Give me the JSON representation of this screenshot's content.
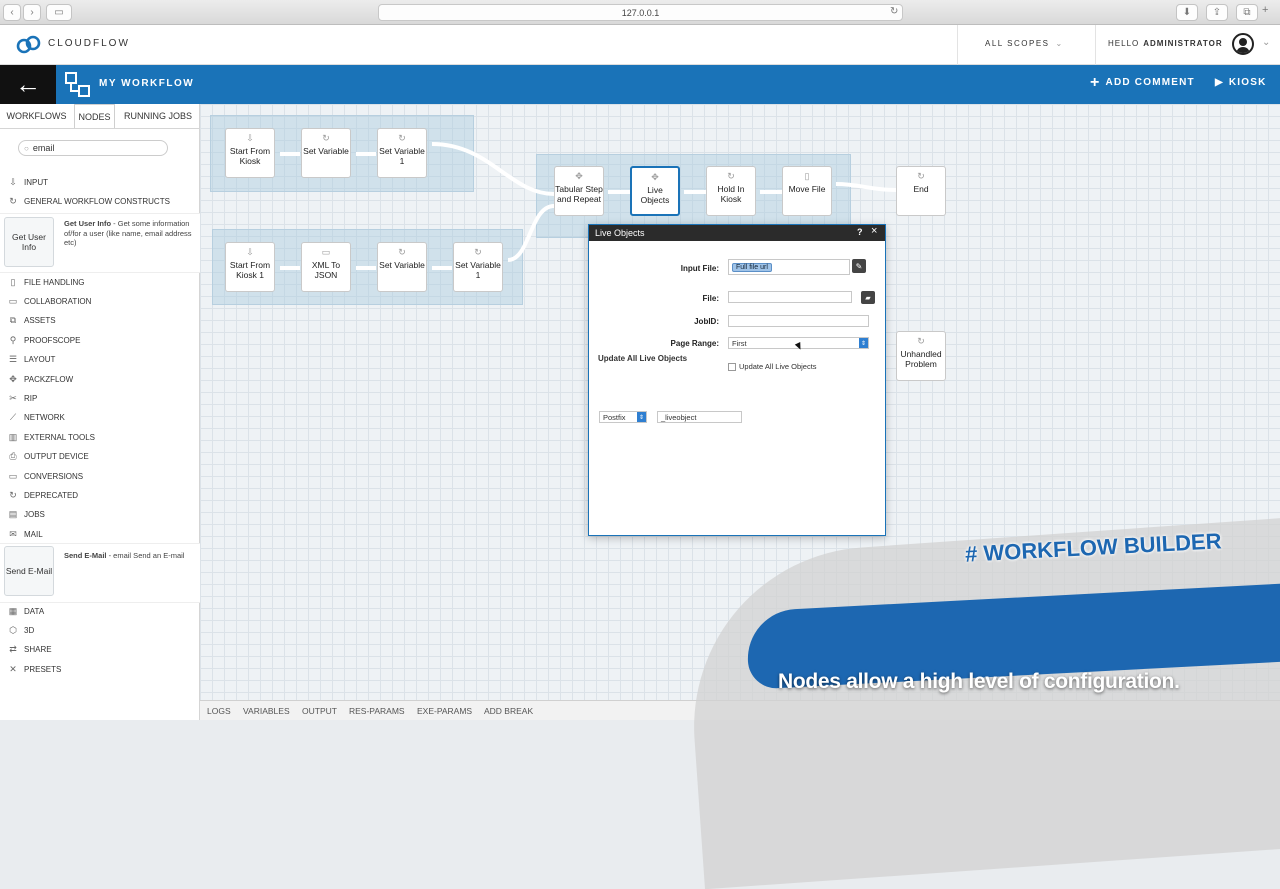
{
  "browser": {
    "url": "127.0.0.1"
  },
  "header": {
    "brand": "CLOUDFLOW",
    "scopes": "ALL SCOPES",
    "greeting": "HELLO",
    "user": "ADMINISTRATOR"
  },
  "toolbar": {
    "title": "MY WORKFLOW",
    "add_comment": "ADD COMMENT",
    "kiosk": "KIOSK"
  },
  "sidebar": {
    "tabs": [
      "WORKFLOWS",
      "NODES",
      "RUNNING JOBS"
    ],
    "search_value": "email",
    "categories_top": [
      {
        "label": "INPUT",
        "icon": "input-icon"
      },
      {
        "label": "GENERAL WORKFLOW CONSTRUCTS",
        "icon": "cycle-icon"
      }
    ],
    "card1": {
      "title": "Get User Info",
      "name": "Get User Info",
      "desc": " - Get some information of/for a user (like name, email address etc)"
    },
    "categories_mid": [
      {
        "label": "FILE HANDLING",
        "icon": "file-icon"
      },
      {
        "label": "COLLABORATION",
        "icon": "collaboration-icon"
      },
      {
        "label": "ASSETS",
        "icon": "assets-icon"
      },
      {
        "label": "PROOFSCOPE",
        "icon": "proofscope-icon"
      },
      {
        "label": "LAYOUT",
        "icon": "layout-icon"
      },
      {
        "label": "PACKZFLOW",
        "icon": "packzflow-icon"
      },
      {
        "label": "RIP",
        "icon": "rip-icon"
      },
      {
        "label": "NETWORK",
        "icon": "network-icon"
      },
      {
        "label": "EXTERNAL TOOLS",
        "icon": "tools-icon"
      },
      {
        "label": "OUTPUT DEVICE",
        "icon": "output-icon"
      },
      {
        "label": "CONVERSIONS",
        "icon": "conversions-icon"
      },
      {
        "label": "DEPRECATED",
        "icon": "deprecated-icon"
      },
      {
        "label": "JOBS",
        "icon": "jobs-icon"
      },
      {
        "label": "MAIL",
        "icon": "mail-icon"
      }
    ],
    "card2": {
      "title": "Send E-Mail",
      "name": "Send E-Mail",
      "desc": " - email Send an E-mail"
    },
    "categories_bottom": [
      {
        "label": "DATA",
        "icon": "data-icon"
      },
      {
        "label": "3D",
        "icon": "3d-icon"
      },
      {
        "label": "SHARE",
        "icon": "share-icon"
      },
      {
        "label": "PRESETS",
        "icon": "presets-icon"
      }
    ]
  },
  "nodes": {
    "start_kiosk": "Start From Kiosk",
    "set_variable": "Set Variable",
    "set_variable_1": "Set Variable 1",
    "start_kiosk_1": "Start From Kiosk 1",
    "xml_json": "XML To JSON",
    "set_variable_b": "Set Variable",
    "set_variable_1b": "Set Variable 1",
    "tabular": "Tabular Step and Repeat",
    "live_objects": "Live Objects",
    "hold_kiosk": "Hold In Kiosk",
    "move_file": "Move File",
    "end": "End",
    "unhandled": "Unhandled Problem"
  },
  "dialog": {
    "title": "Live Objects",
    "help": "?",
    "close": "×",
    "input_file_label": "Input File:",
    "input_file_chip": "Full file url",
    "file_label": "File:",
    "jobid_label": "JobID:",
    "page_range_label": "Page Range:",
    "page_range_value": "First",
    "update_label": "Update All Live Objects",
    "update_checkbox": "Update All Live Objects",
    "postfix_select": "Postfix",
    "postfix_value": "_liveobject"
  },
  "bottombar": [
    "LOGS",
    "VARIABLES",
    "OUTPUT",
    "RES-PARAMS",
    "EXE-PARAMS",
    "ADD BREAK"
  ],
  "overlay": {
    "hashtag": "# WORKFLOW BUILDER",
    "caption": "Nodes allow a high level of configuration."
  },
  "colors": {
    "brand_blue": "#1a73b8",
    "overlay_blue": "#1d67b1"
  }
}
